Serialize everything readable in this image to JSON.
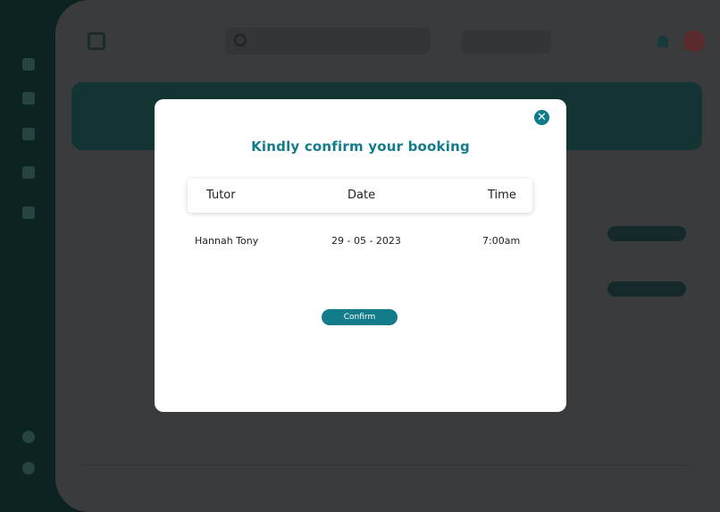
{
  "modal": {
    "title": "Kindly confirm your booking",
    "close_icon": "close-icon",
    "columns": [
      "Tutor",
      "Date",
      "Time"
    ],
    "row": {
      "tutor": "Hannah Tony",
      "date": "29 - 05 - 2023",
      "time": "7:00am"
    },
    "confirm_label": "Confirm",
    "accent_color": "#127c8a"
  },
  "background": {
    "sidebar_icons": [
      "home-icon",
      "calendar-icon",
      "user-icon",
      "star-icon",
      "wallet-icon",
      "settings-icon",
      "logout-icon"
    ],
    "header_icons": [
      "search-icon",
      "bell-icon",
      "avatar"
    ]
  }
}
